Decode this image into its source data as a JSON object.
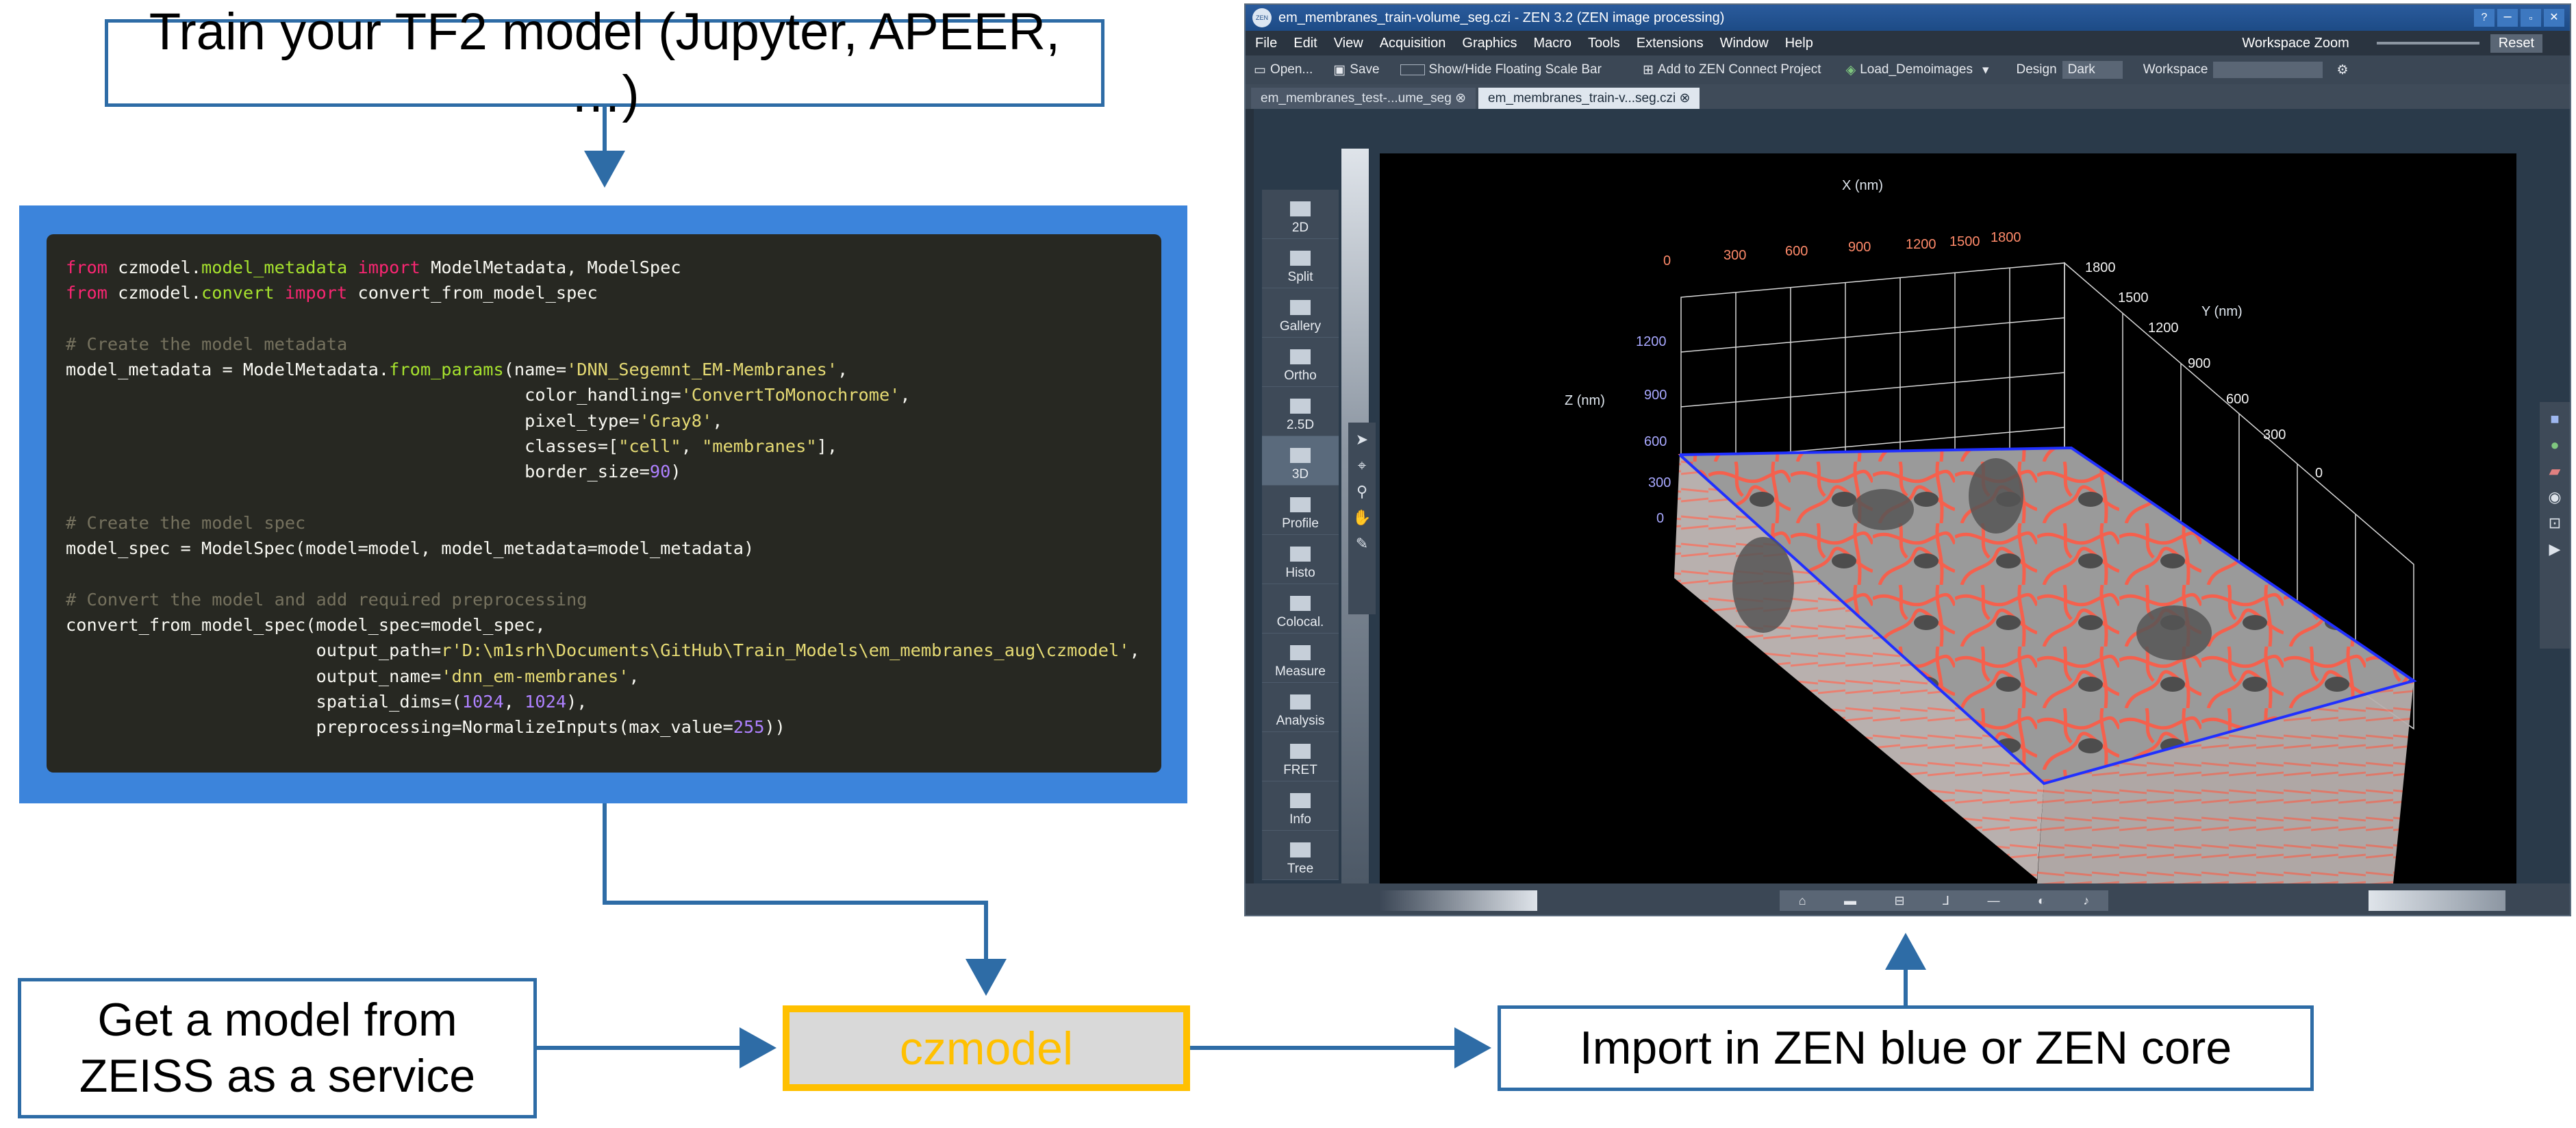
{
  "flow": {
    "train_box": "Train your TF2 model (Jupyter, APEER, …)",
    "zeiss_box_line1": "Get a model from",
    "zeiss_box_line2": "ZEISS as a service",
    "czmodel_box": "czmodel",
    "import_box": "Import in ZEN blue or ZEN core"
  },
  "colors": {
    "box_border": "#2e6ca6",
    "arrow": "#2e6ca6",
    "code_frame": "#3c84db",
    "code_bg": "#272822",
    "czmodel_border": "#ffc000",
    "czmodel_fill": "#d9d9d9",
    "keyword": "#f92672",
    "function": "#a6e22e",
    "string": "#e6db74",
    "number": "#ae81ff",
    "comment": "#75715e",
    "text": "#f8f8f2"
  },
  "code": {
    "lines": [
      [
        {
          "t": "from",
          "c": "keyword"
        },
        {
          "t": " czmodel.",
          "c": "text"
        },
        {
          "t": "model_metadata",
          "c": "function"
        },
        {
          "t": " ",
          "c": "text"
        },
        {
          "t": "import",
          "c": "keyword"
        },
        {
          "t": " ModelMetadata, ModelSpec",
          "c": "text"
        }
      ],
      [
        {
          "t": "from",
          "c": "keyword"
        },
        {
          "t": " czmodel.",
          "c": "text"
        },
        {
          "t": "convert",
          "c": "function"
        },
        {
          "t": " ",
          "c": "text"
        },
        {
          "t": "import",
          "c": "keyword"
        },
        {
          "t": " convert_from_model_spec",
          "c": "text"
        }
      ],
      [],
      [
        {
          "t": "# Create the model metadata",
          "c": "comment"
        }
      ],
      [
        {
          "t": "model_metadata = ModelMetadata.",
          "c": "text"
        },
        {
          "t": "from_params",
          "c": "function"
        },
        {
          "t": "(name=",
          "c": "text"
        },
        {
          "t": "'DNN_Segemnt_EM-Membranes'",
          "c": "string"
        },
        {
          "t": ",",
          "c": "text"
        }
      ],
      [
        {
          "t": "                                            color_handling=",
          "c": "text"
        },
        {
          "t": "'ConvertToMonochrome'",
          "c": "string"
        },
        {
          "t": ",",
          "c": "text"
        }
      ],
      [
        {
          "t": "                                            pixel_type=",
          "c": "text"
        },
        {
          "t": "'Gray8'",
          "c": "string"
        },
        {
          "t": ",",
          "c": "text"
        }
      ],
      [
        {
          "t": "                                            classes=[",
          "c": "text"
        },
        {
          "t": "\"cell\"",
          "c": "string"
        },
        {
          "t": ", ",
          "c": "text"
        },
        {
          "t": "\"membranes\"",
          "c": "string"
        },
        {
          "t": "],",
          "c": "text"
        }
      ],
      [
        {
          "t": "                                            border_size=",
          "c": "text"
        },
        {
          "t": "90",
          "c": "number"
        },
        {
          "t": ")",
          "c": "text"
        }
      ],
      [],
      [
        {
          "t": "# Create the model spec",
          "c": "comment"
        }
      ],
      [
        {
          "t": "model_spec = ModelSpec(model=model, model_metadata=model_metadata)",
          "c": "text"
        }
      ],
      [],
      [
        {
          "t": "# Convert the model and add required preprocessing",
          "c": "comment"
        }
      ],
      [
        {
          "t": "convert_from_model_spec(model_spec=model_spec,",
          "c": "text"
        }
      ],
      [
        {
          "t": "                        output_path=",
          "c": "text"
        },
        {
          "t": "r'D:\\m1srh\\Documents\\GitHub\\Train_Models\\em_membranes_aug\\czmodel'",
          "c": "string"
        },
        {
          "t": ",",
          "c": "text"
        }
      ],
      [
        {
          "t": "                        output_name=",
          "c": "text"
        },
        {
          "t": "'dnn_em-membranes'",
          "c": "string"
        },
        {
          "t": ",",
          "c": "text"
        }
      ],
      [
        {
          "t": "                        spatial_dims=(",
          "c": "text"
        },
        {
          "t": "1024",
          "c": "number"
        },
        {
          "t": ", ",
          "c": "text"
        },
        {
          "t": "1024",
          "c": "number"
        },
        {
          "t": "),",
          "c": "text"
        }
      ],
      [
        {
          "t": "                        preprocessing=NormalizeInputs(max_value=",
          "c": "text"
        },
        {
          "t": "255",
          "c": "number"
        },
        {
          "t": "))",
          "c": "text"
        }
      ]
    ]
  },
  "zen": {
    "title": "em_membranes_train-volume_seg.czi - ZEN 3.2 (ZEN image processing)",
    "logo": "ZEN",
    "menu": [
      "File",
      "Edit",
      "View",
      "Acquisition",
      "Graphics",
      "Macro",
      "Tools",
      "Extensions",
      "Window",
      "Help"
    ],
    "workspace_zoom_label": "Workspace Zoom",
    "reset_label": "Reset",
    "toolbar": {
      "open": "Open...",
      "save": "Save",
      "scale_bar": "Show/Hide Floating Scale Bar",
      "zen_connect": "Add to ZEN Connect Project",
      "demo": "Load_Demoimages",
      "design_label": "Design",
      "design_value": "Dark",
      "workspace_label": "Workspace"
    },
    "tabs": [
      "em_membranes_test-...ume_seg",
      "em_membranes_train-v...seg.czi"
    ],
    "sidebar": [
      "2D",
      "Split",
      "Gallery",
      "Ortho",
      "2.5D",
      "3D",
      "Profile",
      "Histo",
      "Colocal.",
      "Measure",
      "Analysis",
      "FRET",
      "Info",
      "Tree"
    ],
    "viewer": {
      "x_title": "X (nm)",
      "y_title": "Y (nm)",
      "z_title": "Z (nm)",
      "x_ticks": [
        "0",
        "300",
        "600",
        "900",
        "1200",
        "1500",
        "1800"
      ],
      "y_ticks": [
        "1800",
        "1500",
        "1200",
        "900",
        "600",
        "300",
        "0"
      ],
      "z_ticks": [
        "1200",
        "900",
        "600",
        "300",
        "0"
      ]
    }
  }
}
